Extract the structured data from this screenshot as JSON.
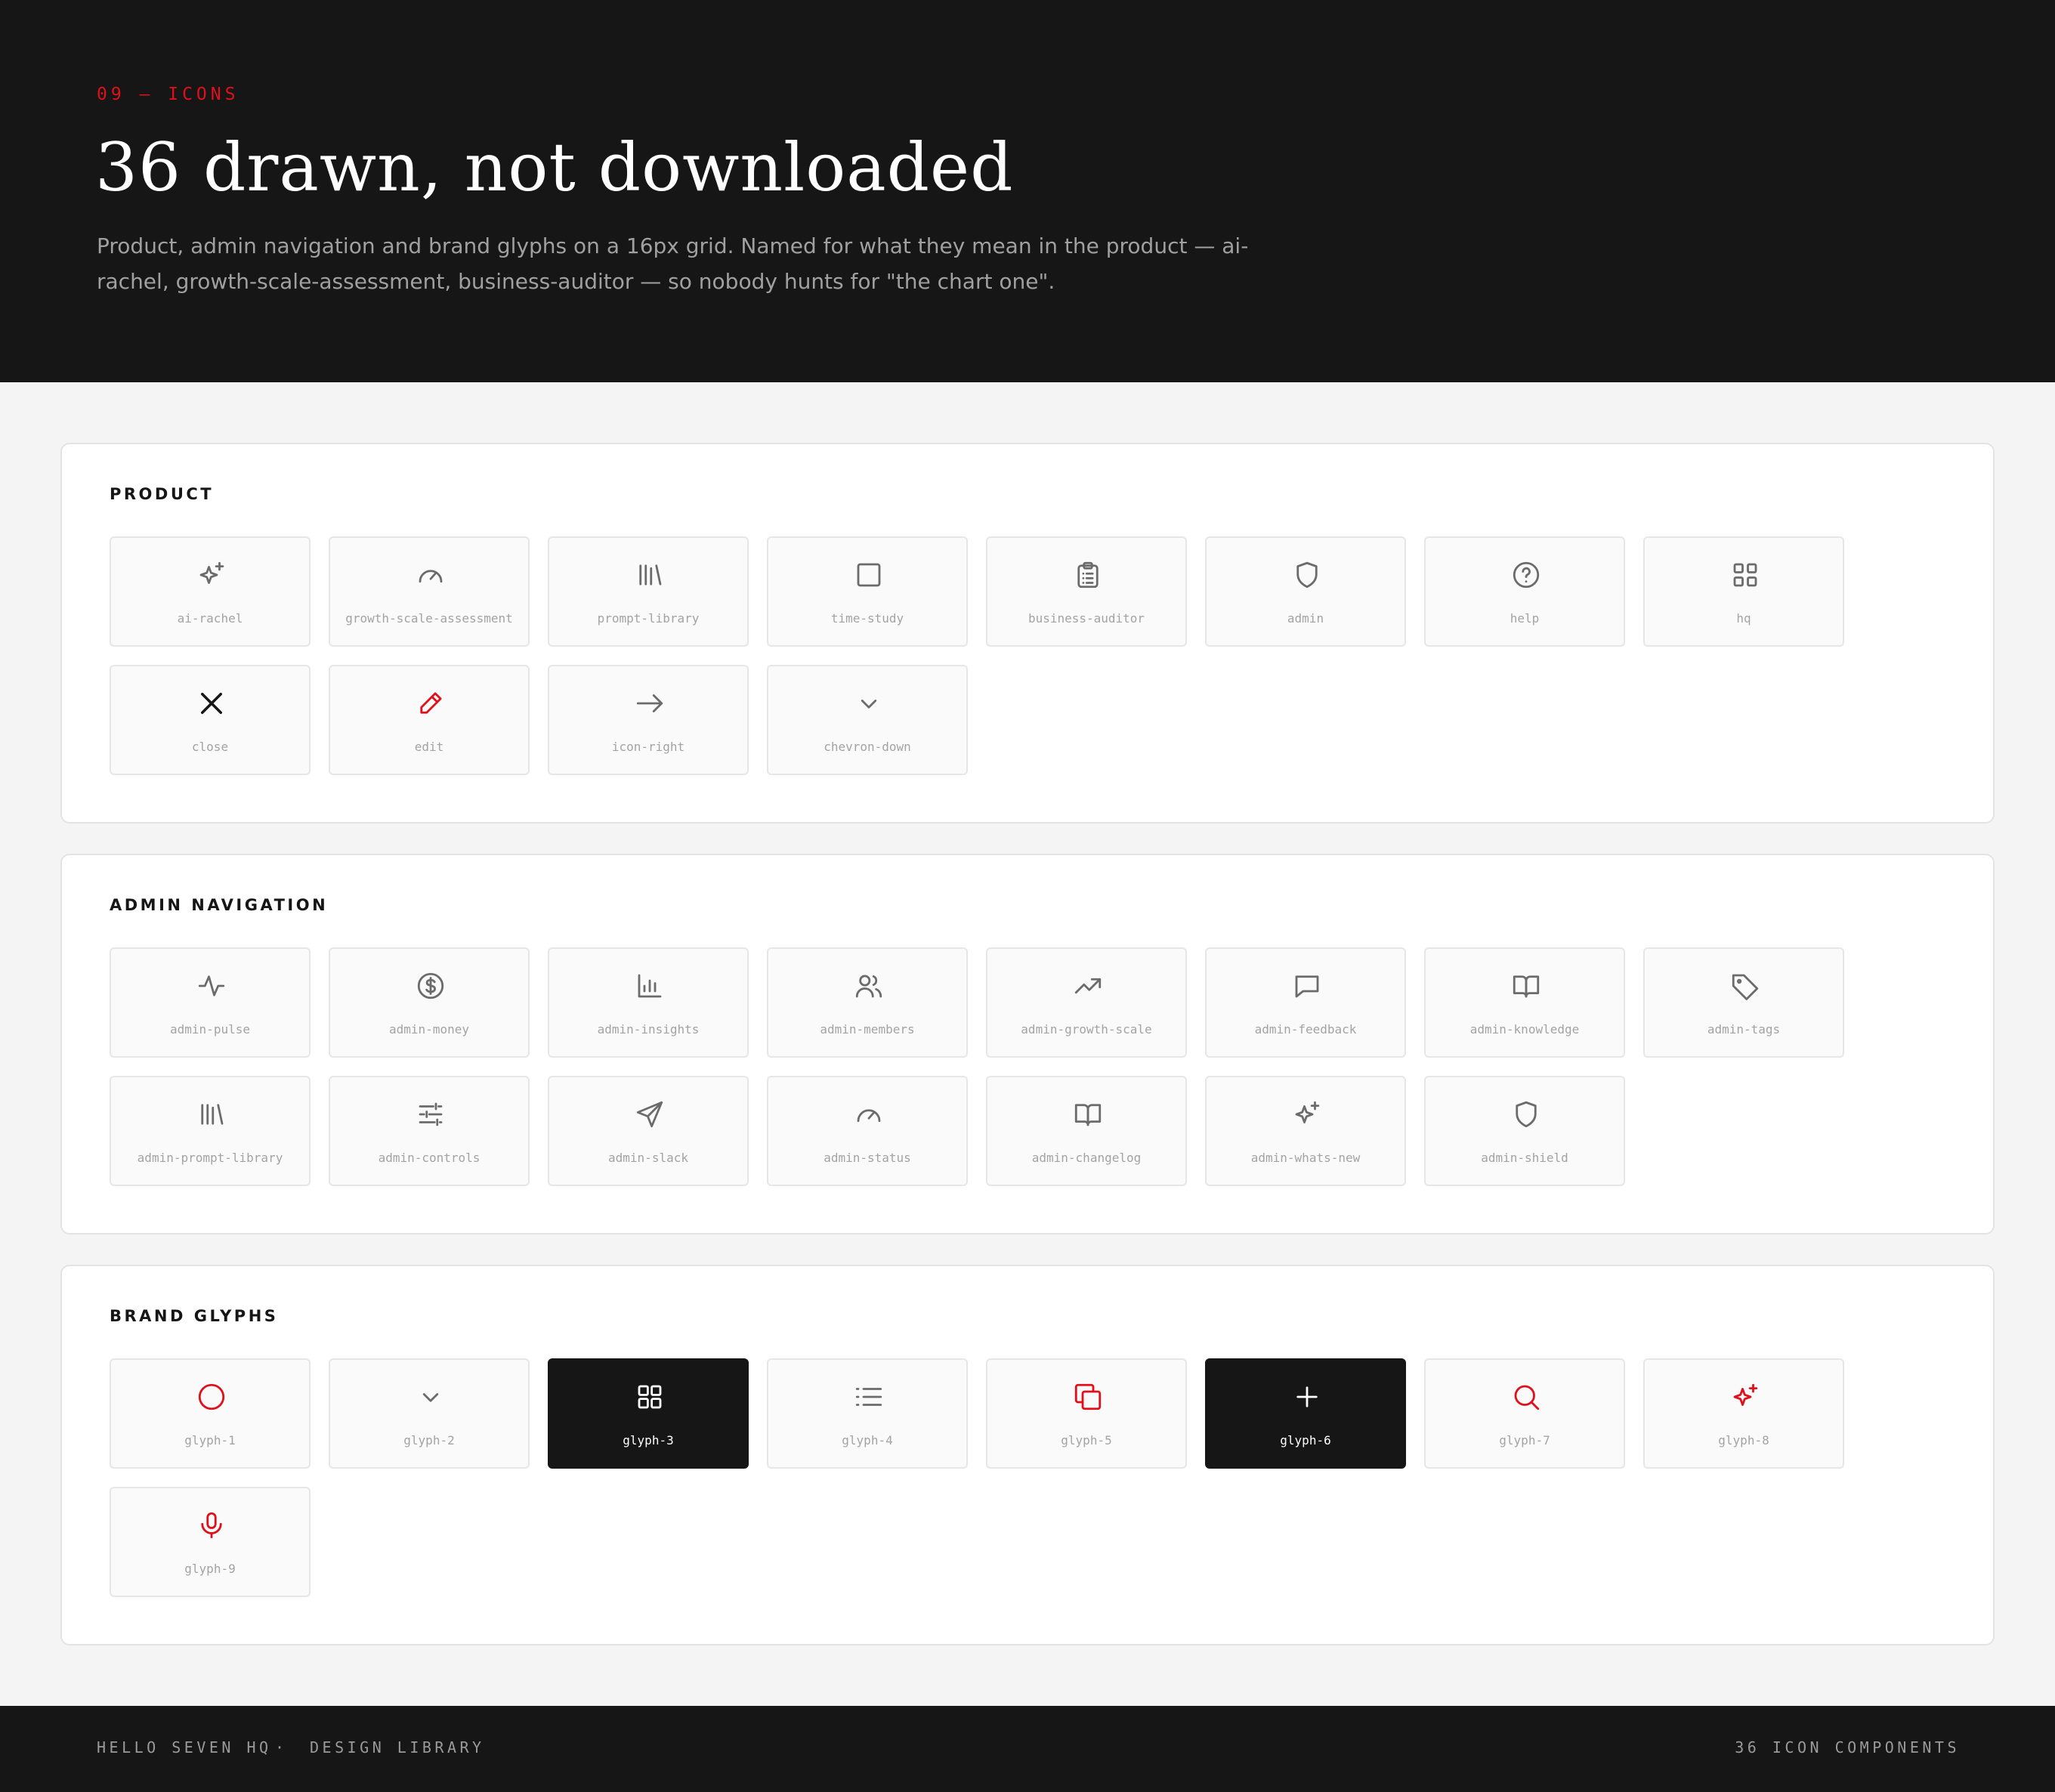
{
  "header": {
    "eyebrow": "09 — ICONS",
    "title": "36 drawn, not downloaded",
    "description": "Product, admin navigation and brand glyphs on a 16px grid. Named for what they mean in the product — ai-rachel, growth-scale-assessment, business-auditor — so nobody hunts for \"the chart one\"."
  },
  "colors": {
    "accent": "#e0101a",
    "dark": "#161616",
    "icon_gray": "#6b6b6b",
    "label_gray": "#a3a3a3",
    "page_bg": "#f4f4f4"
  },
  "sections": [
    {
      "label": "PRODUCT",
      "icons": [
        {
          "label": "ai-rachel",
          "icon": "sparkle-icon"
        },
        {
          "label": "growth-scale-assessment",
          "icon": "gauge-icon"
        },
        {
          "label": "prompt-library",
          "icon": "library-icon"
        },
        {
          "label": "time-study",
          "icon": "square-icon"
        },
        {
          "label": "business-auditor",
          "icon": "clipboard-icon"
        },
        {
          "label": "admin",
          "icon": "shield-icon"
        },
        {
          "label": "help",
          "icon": "help-circle-icon"
        },
        {
          "label": "hq",
          "icon": "layout-grid-icon"
        },
        {
          "label": "close",
          "icon": "close-icon",
          "tone": "dark"
        },
        {
          "label": "edit",
          "icon": "pencil-icon",
          "tone": "accent"
        },
        {
          "label": "icon-right",
          "icon": "arrow-right-icon"
        },
        {
          "label": "chevron-down",
          "icon": "chevron-down-icon"
        }
      ]
    },
    {
      "label": "ADMIN NAVIGATION",
      "icons": [
        {
          "label": "admin-pulse",
          "icon": "pulse-icon"
        },
        {
          "label": "admin-money",
          "icon": "dollar-circle-icon"
        },
        {
          "label": "admin-insights",
          "icon": "bar-chart-icon"
        },
        {
          "label": "admin-members",
          "icon": "users-icon"
        },
        {
          "label": "admin-growth-scale",
          "icon": "trending-up-icon"
        },
        {
          "label": "admin-feedback",
          "icon": "message-square-icon"
        },
        {
          "label": "admin-knowledge",
          "icon": "book-open-icon"
        },
        {
          "label": "admin-tags",
          "icon": "tag-icon"
        },
        {
          "label": "admin-prompt-library",
          "icon": "library-icon"
        },
        {
          "label": "admin-controls",
          "icon": "sliders-icon"
        },
        {
          "label": "admin-slack",
          "icon": "send-icon"
        },
        {
          "label": "admin-status",
          "icon": "gauge-icon"
        },
        {
          "label": "admin-changelog",
          "icon": "book-open-icon"
        },
        {
          "label": "admin-whats-new",
          "icon": "sparkle-icon"
        },
        {
          "label": "admin-shield",
          "icon": "shield-icon"
        }
      ]
    },
    {
      "label": "BRAND GLYPHS",
      "icons": [
        {
          "label": "glyph-1",
          "icon": "circle-icon",
          "tone": "accent"
        },
        {
          "label": "glyph-2",
          "icon": "chevron-down-icon"
        },
        {
          "label": "glyph-3",
          "icon": "grid-icon",
          "selected": true
        },
        {
          "label": "glyph-4",
          "icon": "list-icon"
        },
        {
          "label": "glyph-5",
          "icon": "copy-icon",
          "tone": "accent"
        },
        {
          "label": "glyph-6",
          "icon": "plus-icon",
          "selected": true
        },
        {
          "label": "glyph-7",
          "icon": "search-icon",
          "tone": "accent"
        },
        {
          "label": "glyph-8",
          "icon": "sparkle-icon",
          "tone": "accent"
        },
        {
          "label": "glyph-9",
          "icon": "mic-icon",
          "tone": "accent"
        }
      ]
    }
  ],
  "footer": {
    "brand": "HELLO SEVEN HQ",
    "separator": "·",
    "library": "DESIGN LIBRARY",
    "count": "36 ICON COMPONENTS"
  }
}
